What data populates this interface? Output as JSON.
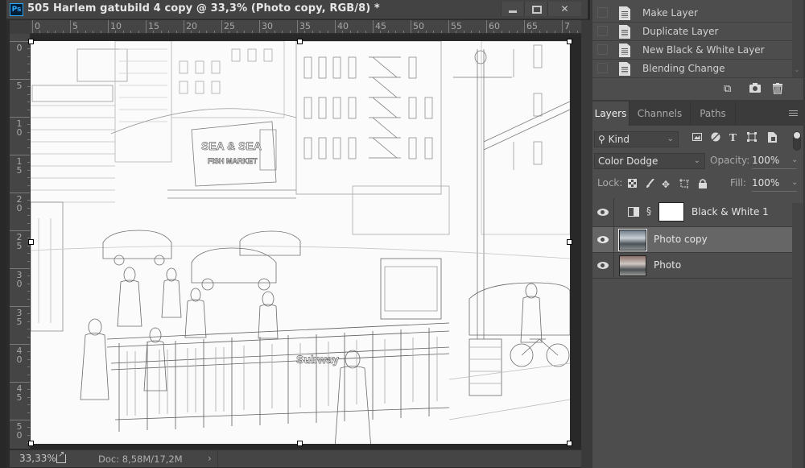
{
  "app": {
    "logo_text": "Ps",
    "document_title": "505 Harlem gatubild 4 copy @ 33,3% (Photo copy, RGB/8) *"
  },
  "window_controls": {
    "minimize": "minimize",
    "maximize": "maximize",
    "close": "✕"
  },
  "rulers": {
    "horizontal_labels": [
      "0",
      "5",
      "10",
      "15",
      "20",
      "25",
      "30",
      "35",
      "40",
      "45",
      "50",
      "55",
      "60",
      "65",
      "7"
    ],
    "vertical_labels": [
      "0",
      "5",
      "1\n0",
      "1\n5",
      "2\n0",
      "2\n5",
      "3\n0",
      "3\n5",
      "4\n0",
      "4\n5",
      "5\n0"
    ]
  },
  "canvas": {
    "image_description": "Pencil-sketch (Color Dodge) rendering of a Harlem street scene with subway entrance",
    "signs": {
      "shop": "SEA & SEA",
      "shop_sub": "FISH MARKET",
      "subway": "Subway"
    }
  },
  "status_bar": {
    "zoom": "33,33%",
    "doc_size": "Doc: 8,58M/17,2M",
    "arrow": "›"
  },
  "history": {
    "items": [
      {
        "label": "Make Layer"
      },
      {
        "label": "Duplicate Layer"
      },
      {
        "label": "New Black & White Layer"
      },
      {
        "label": "Blending Change"
      }
    ],
    "footer_icons": [
      "new-document-from-state-icon",
      "camera-icon",
      "trash-icon"
    ]
  },
  "layers_panel": {
    "tabs": [
      {
        "label": "Layers",
        "active": true
      },
      {
        "label": "Channels",
        "active": false
      },
      {
        "label": "Paths",
        "active": false
      }
    ],
    "filter": {
      "kind_label": "Kind",
      "arrow": "⌄"
    },
    "blend_mode": "Color Dodge",
    "opacity_label": "Opacity:",
    "opacity_value": "100%",
    "lock_label": "Lock:",
    "fill_label": "Fill:",
    "fill_value": "100%",
    "layers": [
      {
        "name": "Black & White 1",
        "type": "adjustment",
        "visible": true,
        "selected": false
      },
      {
        "name": "Photo copy",
        "type": "pixel",
        "visible": true,
        "selected": true
      },
      {
        "name": "Photo",
        "type": "pixel",
        "visible": true,
        "selected": false
      }
    ]
  }
}
